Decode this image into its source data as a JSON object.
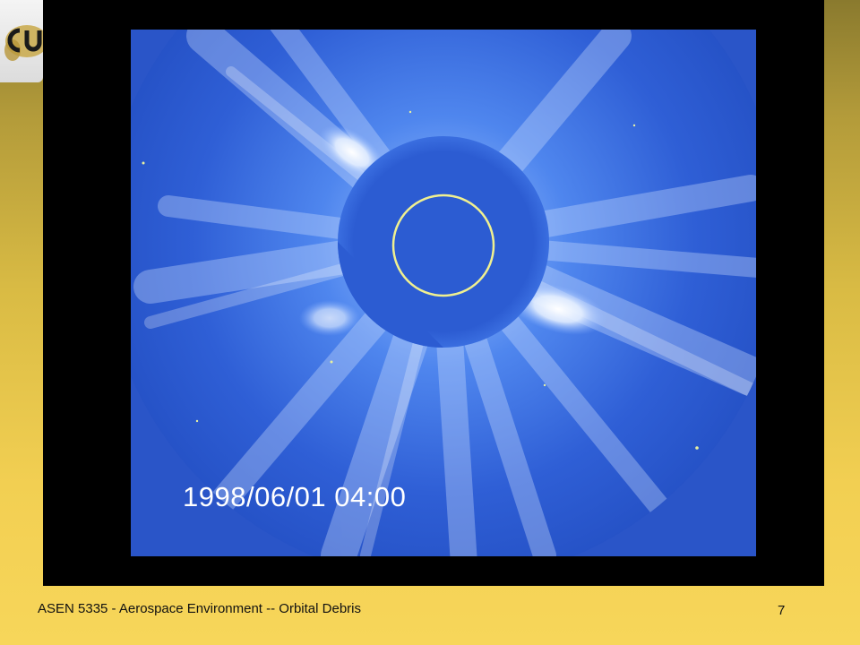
{
  "slide": {
    "footer": "ASEN 5335 - Aerospace Environment -- Orbital Debris",
    "page_number": "7"
  },
  "image": {
    "timestamp": "1998/06/01 04:00"
  },
  "colors": {
    "frame": "#000000",
    "sky_blue": "#2f5fd6",
    "occulter": "#2c5cd2",
    "sun_ring": "#f0f090",
    "slide_gold": "#f2cf52"
  }
}
